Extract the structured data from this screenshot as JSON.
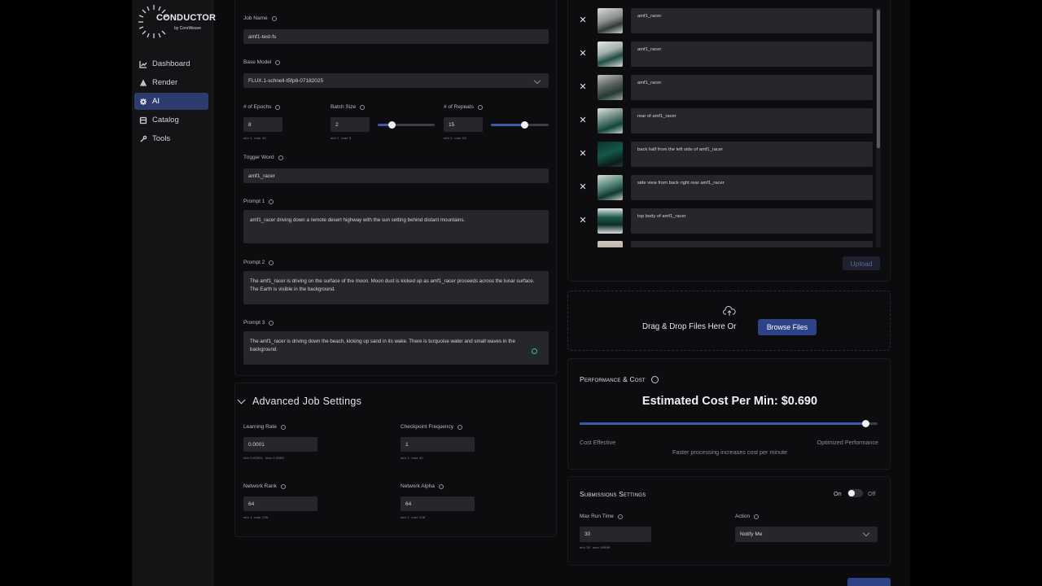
{
  "sidebar": {
    "logo_title": "CONDUCTOR",
    "logo_subtitle": "by CoreWeave",
    "items": [
      {
        "label": "Dashboard",
        "icon": "chart-icon"
      },
      {
        "label": "Render",
        "icon": "render-icon"
      },
      {
        "label": "AI",
        "icon": "ai-icon",
        "active": true
      },
      {
        "label": "Catalog",
        "icon": "catalog-icon"
      },
      {
        "label": "Tools",
        "icon": "tools-icon"
      }
    ]
  },
  "form": {
    "job_name": {
      "label": "Job Name",
      "value": "amf1-test-fs"
    },
    "base_model": {
      "label": "Base Model",
      "value": "FLUX.1-schnell-t5fp8-07182025"
    },
    "epochs": {
      "label": "# of Epochs",
      "value": "8",
      "min": "1",
      "max": "40",
      "min_label": "min",
      "max_label": "max"
    },
    "batch_size": {
      "label": "Batch Size",
      "value": "2",
      "min": "1",
      "max": "5",
      "min_label": "min",
      "max_label": "max",
      "level": 0.25
    },
    "repeats": {
      "label": "# of Repeats",
      "value": "15",
      "min": "1",
      "max": "25",
      "min_label": "min",
      "max_label": "max",
      "level": 0.58
    },
    "trigger_word": {
      "label": "Trigger Word",
      "value": "amf1_racer"
    },
    "prompt1": {
      "label": "Prompt 1",
      "value": "amf1_racer driving down a remote desert highway with the sun setting behind distant mountains."
    },
    "prompt2": {
      "label": "Prompt 2",
      "value": "The amf1_racer is driving on the surface of the moon. Moon dust is kicked up as amf1_racer proceeds across the lunar surface. The Earth is visible in the background."
    },
    "prompt3": {
      "label": "Prompt 3",
      "value": "The amf1_racer is driving down the beach, kicking up sand in its wake. There is turquoise water and small waves in the background."
    }
  },
  "advanced": {
    "title": "Advanced Job Settings",
    "learning_rate": {
      "label": "Learning Rate",
      "value": "0.0001",
      "min": "0.00001",
      "max": "0.0005",
      "min_label": "min",
      "max_label": "max"
    },
    "checkpoint_frequency": {
      "label": "Checkpoint Frequency",
      "value": "1",
      "min": "1",
      "max": "40",
      "min_label": "min",
      "max_label": "max"
    },
    "network_rank": {
      "label": "Network Rank",
      "value": "64",
      "min": "1",
      "max": "128",
      "min_label": "min",
      "max_label": "max"
    },
    "network_alpha": {
      "label": "Network Alpha",
      "value": "64",
      "min": "1",
      "max": "128",
      "min_label": "min",
      "max_label": "max"
    }
  },
  "images": [
    {
      "caption": "amf1_racer"
    },
    {
      "caption": "amf1_racer"
    },
    {
      "caption": "amf1_racer"
    },
    {
      "caption": "rear of amf1_racer"
    },
    {
      "caption": "back half from the left side of amf1_racer"
    },
    {
      "caption": "side view from back right rear amf1_racer"
    },
    {
      "caption": "top body of amf1_racer"
    }
  ],
  "upload_label": "Upload",
  "drop": {
    "text": "Drag & Drop Files Here Or",
    "browse_label": "Browse Files"
  },
  "performance": {
    "title": "Performance & Cost",
    "estimated": "Estimated Cost Per Min: $0.690",
    "left_label": "Cost Effective",
    "right_label": "Optimized Performance",
    "note": "Faster processing increases cost per minute",
    "level": 0.96
  },
  "submissions": {
    "title": "Submissions Settings",
    "on_label": "On",
    "off_label": "Off",
    "max_run_time": {
      "label": "Max Run Time",
      "value": "30",
      "min": "30",
      "max": "99999",
      "min_label": "min",
      "max_label": "max"
    },
    "action": {
      "label": "Action",
      "value": "Notify Me"
    }
  },
  "colors": {
    "accent": "#2e4387",
    "active_nav": "#2d3c6e",
    "field_bg": "#26272c"
  }
}
